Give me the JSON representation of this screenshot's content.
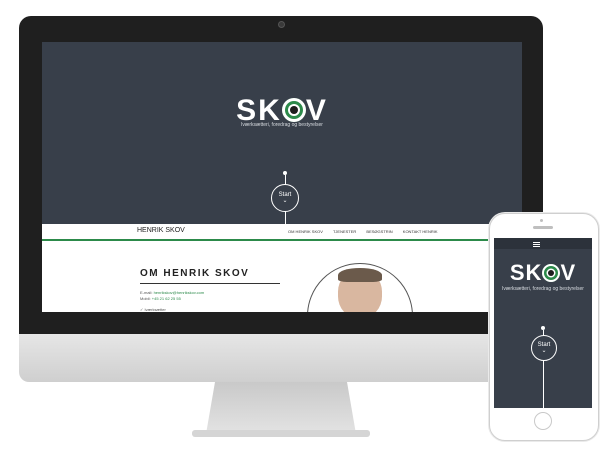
{
  "brand": {
    "logo_left": "SK",
    "logo_right": "V",
    "tagline": "Iværksætteri, foredrag og bestyrelser",
    "accent_color": "#2c8a4a",
    "hero_bg": "#383f4a"
  },
  "hero": {
    "start_label": "Start",
    "start_chevron": "⌄"
  },
  "nav": {
    "brand": "HENRIK SKOV",
    "links": [
      "OM HENRIK SKOV",
      "TJENESTER",
      "BESØGSTRIN",
      "KONTAKT HENRIK"
    ]
  },
  "about": {
    "title": "OM HENRIK SKOV",
    "email_label": "E-mail: ",
    "email": "henrikskov@henrikskov.com",
    "phone_label": "Mobil: ",
    "phone": "+45 21 62 25 55",
    "check_text": "Iværksætter"
  },
  "mobile": {
    "menu_icon": "hamburger-icon",
    "start_label": "Start",
    "start_chevron": "⌄"
  }
}
